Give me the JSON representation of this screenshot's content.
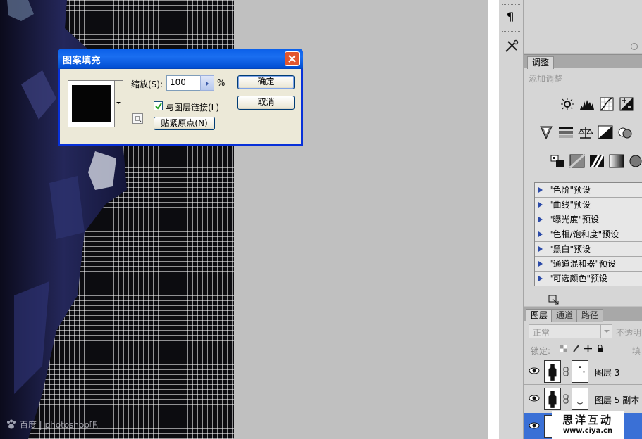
{
  "dialog": {
    "title": "图案填充",
    "scale_label": "缩放(S):",
    "scale_value": "100",
    "scale_unit": "%",
    "link_label": "与图层链接(L)",
    "link_checked": true,
    "snap_label": "贴紧原点(N)",
    "ok_label": "确定",
    "cancel_label": "取消"
  },
  "canvas": {
    "watermark": "百度 | photoshop吧"
  },
  "adjust_panel": {
    "tab": "调整",
    "add_label": "添加调整",
    "presets": [
      "\"色阶\"预设",
      "\"曲线\"预设",
      "\"曝光度\"预设",
      "\"色相/饱和度\"预设",
      "\"黑白\"预设",
      "\"通道混和器\"预设",
      "\"可选颜色\"预设"
    ]
  },
  "layers_panel": {
    "tabs": [
      "图层",
      "通道",
      "路径"
    ],
    "blend_mode": "正常",
    "opacity_label": "不透明",
    "lock_label": "锁定:",
    "fill_label": "填",
    "layers": [
      {
        "name": "图层 3"
      },
      {
        "name": "图层 5 副本"
      },
      {
        "name": ""
      }
    ]
  },
  "badge": {
    "cn": "思洋互动",
    "url": "www.ciya.cn"
  },
  "colors": {
    "xp_title_blue": "#0a5fe8",
    "close_red": "#e2562f",
    "panel_grey": "#d6d6d6",
    "pasteboard": "#c0c0c0"
  }
}
